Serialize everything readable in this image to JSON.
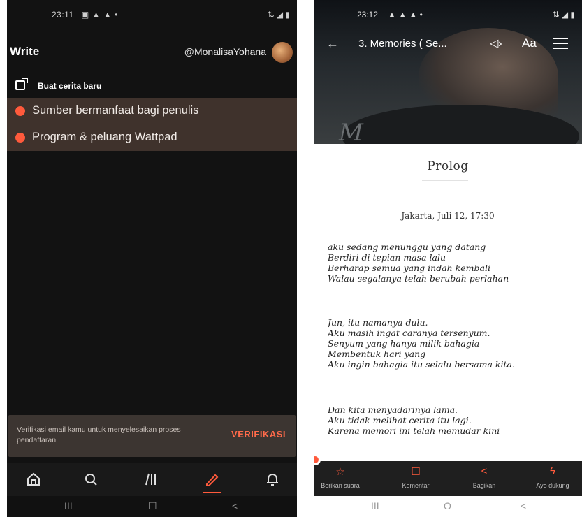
{
  "left": {
    "status_bar": {
      "time": "23:11",
      "icons": "▣ ▲ ▲ •",
      "right": "⇅ ◢ ▮"
    },
    "header": {
      "title": "Write",
      "username": "@MonalisaYohana"
    },
    "new_story": {
      "label": "Buat cerita baru"
    },
    "menu": [
      {
        "label": "Sumber bermanfaat bagi penulis"
      },
      {
        "label": "Program & peluang Wattpad"
      }
    ],
    "verify": {
      "message": "Verifikasi email kamu untuk menyelesaikan proses pendaftaran",
      "button": "VERIFIKASI"
    },
    "bottom_nav": [
      "home-icon",
      "search-icon",
      "library-icon",
      "write-icon",
      "notification-icon"
    ],
    "system_nav": {
      "recent": "III",
      "home": "☐",
      "back": "<"
    }
  },
  "right": {
    "status_bar": {
      "time": "23:12",
      "icons": "▲ ▲ ▲ •",
      "right": "⇅ ◢ ▮"
    },
    "toolbar": {
      "back": "←",
      "title": "3. Memories ( Se...",
      "audio": "◁›",
      "font": "Aa"
    },
    "chapter_title": "Prolog",
    "date_line": "Jakarta, Juli 12, 17:30",
    "paragraphs": [
      [
        "aku sedang menunggu yang datang",
        "Berdiri di tepian masa lalu",
        "Berharap semua yang indah kembali",
        "Walau segalanya telah berubah perlahan"
      ],
      [
        "Jun, itu namanya dulu.",
        "Aku masih ingat caranya tersenyum.",
        "Senyum yang hanya milik bahagia",
        "Membentuk hari yang",
        "Aku ingin bahagia itu selalu bersama kita."
      ],
      [
        "Dan kita menyadarinya lama.",
        "Aku tidak melihat cerita itu lagi.",
        "Karena memori ini telah memudar kini"
      ]
    ],
    "actions": [
      {
        "icon": "☆",
        "label": "Berikan suara"
      },
      {
        "icon": "☐",
        "label": "Komentar"
      },
      {
        "icon": "<",
        "label": "Bagikan"
      },
      {
        "icon": "ϟ",
        "label": "Ayo dukung"
      }
    ],
    "system_nav": {
      "recent": "III",
      "home": "O",
      "back": "<"
    }
  }
}
